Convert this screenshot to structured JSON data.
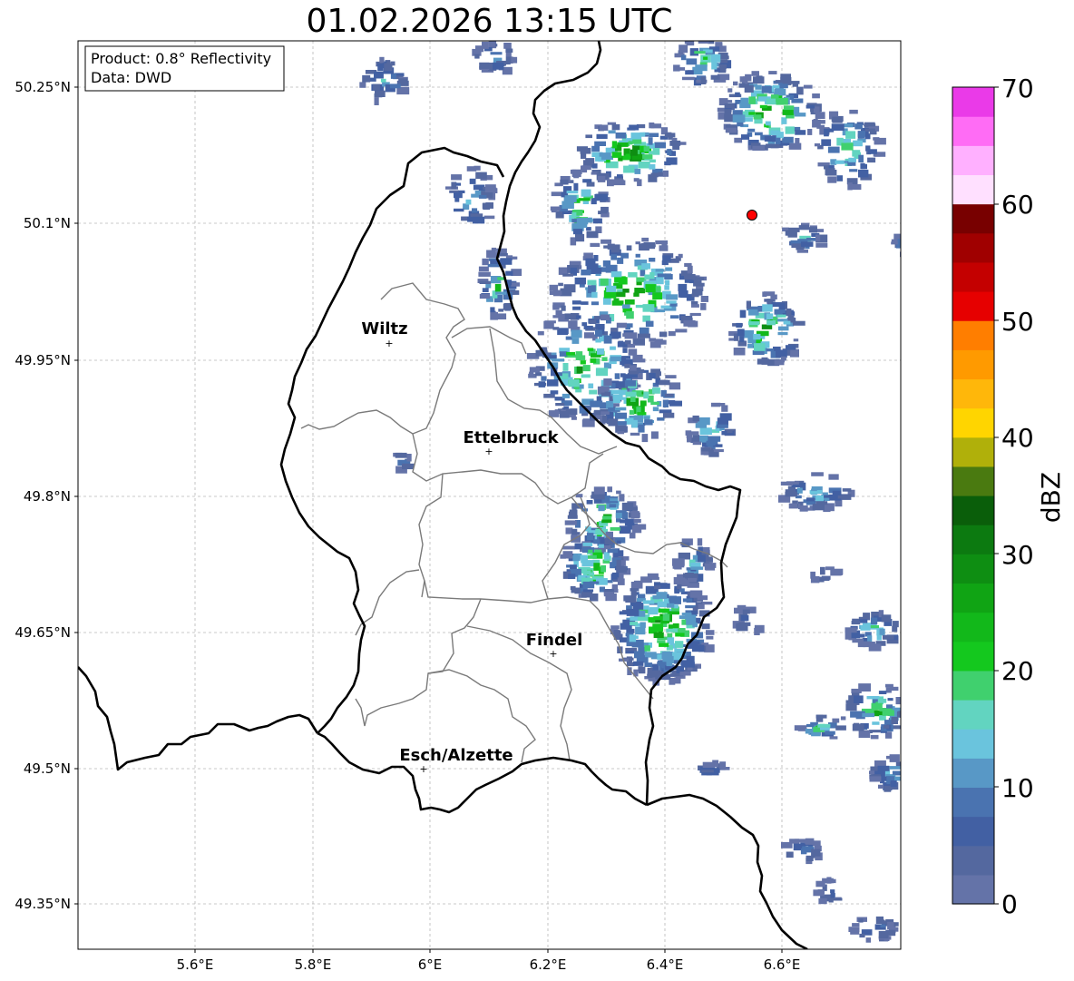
{
  "title": "01.02.2026 13:15 UTC",
  "info_box": {
    "product": "Product: 0.8° Reflectivity",
    "data_source": "Data: DWD"
  },
  "axes": {
    "lon_ticks": [
      "5.6°E",
      "5.8°E",
      "6°E",
      "6.2°E",
      "6.4°E",
      "6.6°E"
    ],
    "lat_ticks": [
      "50.25°N",
      "50.1°N",
      "49.95°N",
      "49.8°N",
      "49.65°N",
      "49.5°N",
      "49.35°N"
    ]
  },
  "places": [
    {
      "name": "Wiltz",
      "lon": 5.93,
      "lat": 49.97
    },
    {
      "name": "Ettelbruck",
      "lon": 6.1,
      "lat": 49.85
    },
    {
      "name": "Findel",
      "lon": 6.21,
      "lat": 49.63
    },
    {
      "name": "Esch/Alzette",
      "lon": 5.99,
      "lat": 49.5
    }
  ],
  "radar_site": {
    "lon": 6.55,
    "lat": 50.11,
    "color": "#ff0000"
  },
  "colorbar": {
    "label": "dBZ",
    "ticks": [
      "0",
      "10",
      "20",
      "30",
      "40",
      "50",
      "60",
      "70"
    ],
    "colors": [
      "#6473a8",
      "#54689f",
      "#4260a3",
      "#4a73b0",
      "#5898c6",
      "#6ac4dd",
      "#62d4c0",
      "#40d06e",
      "#14c81e",
      "#12b81a",
      "#10a414",
      "#0e8e12",
      "#0c7a10",
      "#0a5e0a",
      "#4a7a10",
      "#b0b00a",
      "#ffd500",
      "#ffb70a",
      "#ff9a00",
      "#ff7e00",
      "#e60000",
      "#c40000",
      "#a00000",
      "#780000",
      "#ffe0ff",
      "#ffb0ff",
      "#ff6cf5",
      "#ea3ae8"
    ]
  }
}
